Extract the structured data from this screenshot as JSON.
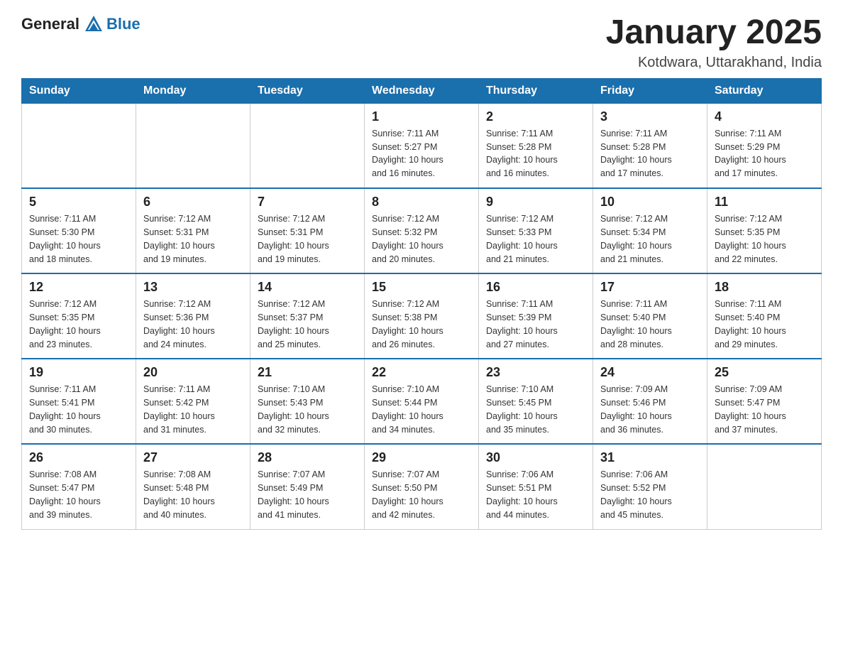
{
  "logo": {
    "text_general": "General",
    "text_blue": "Blue"
  },
  "title": "January 2025",
  "subtitle": "Kotdwara, Uttarakhand, India",
  "days_of_week": [
    "Sunday",
    "Monday",
    "Tuesday",
    "Wednesday",
    "Thursday",
    "Friday",
    "Saturday"
  ],
  "weeks": [
    [
      {
        "day": "",
        "info": ""
      },
      {
        "day": "",
        "info": ""
      },
      {
        "day": "",
        "info": ""
      },
      {
        "day": "1",
        "info": "Sunrise: 7:11 AM\nSunset: 5:27 PM\nDaylight: 10 hours\nand 16 minutes."
      },
      {
        "day": "2",
        "info": "Sunrise: 7:11 AM\nSunset: 5:28 PM\nDaylight: 10 hours\nand 16 minutes."
      },
      {
        "day": "3",
        "info": "Sunrise: 7:11 AM\nSunset: 5:28 PM\nDaylight: 10 hours\nand 17 minutes."
      },
      {
        "day": "4",
        "info": "Sunrise: 7:11 AM\nSunset: 5:29 PM\nDaylight: 10 hours\nand 17 minutes."
      }
    ],
    [
      {
        "day": "5",
        "info": "Sunrise: 7:11 AM\nSunset: 5:30 PM\nDaylight: 10 hours\nand 18 minutes."
      },
      {
        "day": "6",
        "info": "Sunrise: 7:12 AM\nSunset: 5:31 PM\nDaylight: 10 hours\nand 19 minutes."
      },
      {
        "day": "7",
        "info": "Sunrise: 7:12 AM\nSunset: 5:31 PM\nDaylight: 10 hours\nand 19 minutes."
      },
      {
        "day": "8",
        "info": "Sunrise: 7:12 AM\nSunset: 5:32 PM\nDaylight: 10 hours\nand 20 minutes."
      },
      {
        "day": "9",
        "info": "Sunrise: 7:12 AM\nSunset: 5:33 PM\nDaylight: 10 hours\nand 21 minutes."
      },
      {
        "day": "10",
        "info": "Sunrise: 7:12 AM\nSunset: 5:34 PM\nDaylight: 10 hours\nand 21 minutes."
      },
      {
        "day": "11",
        "info": "Sunrise: 7:12 AM\nSunset: 5:35 PM\nDaylight: 10 hours\nand 22 minutes."
      }
    ],
    [
      {
        "day": "12",
        "info": "Sunrise: 7:12 AM\nSunset: 5:35 PM\nDaylight: 10 hours\nand 23 minutes."
      },
      {
        "day": "13",
        "info": "Sunrise: 7:12 AM\nSunset: 5:36 PM\nDaylight: 10 hours\nand 24 minutes."
      },
      {
        "day": "14",
        "info": "Sunrise: 7:12 AM\nSunset: 5:37 PM\nDaylight: 10 hours\nand 25 minutes."
      },
      {
        "day": "15",
        "info": "Sunrise: 7:12 AM\nSunset: 5:38 PM\nDaylight: 10 hours\nand 26 minutes."
      },
      {
        "day": "16",
        "info": "Sunrise: 7:11 AM\nSunset: 5:39 PM\nDaylight: 10 hours\nand 27 minutes."
      },
      {
        "day": "17",
        "info": "Sunrise: 7:11 AM\nSunset: 5:40 PM\nDaylight: 10 hours\nand 28 minutes."
      },
      {
        "day": "18",
        "info": "Sunrise: 7:11 AM\nSunset: 5:40 PM\nDaylight: 10 hours\nand 29 minutes."
      }
    ],
    [
      {
        "day": "19",
        "info": "Sunrise: 7:11 AM\nSunset: 5:41 PM\nDaylight: 10 hours\nand 30 minutes."
      },
      {
        "day": "20",
        "info": "Sunrise: 7:11 AM\nSunset: 5:42 PM\nDaylight: 10 hours\nand 31 minutes."
      },
      {
        "day": "21",
        "info": "Sunrise: 7:10 AM\nSunset: 5:43 PM\nDaylight: 10 hours\nand 32 minutes."
      },
      {
        "day": "22",
        "info": "Sunrise: 7:10 AM\nSunset: 5:44 PM\nDaylight: 10 hours\nand 34 minutes."
      },
      {
        "day": "23",
        "info": "Sunrise: 7:10 AM\nSunset: 5:45 PM\nDaylight: 10 hours\nand 35 minutes."
      },
      {
        "day": "24",
        "info": "Sunrise: 7:09 AM\nSunset: 5:46 PM\nDaylight: 10 hours\nand 36 minutes."
      },
      {
        "day": "25",
        "info": "Sunrise: 7:09 AM\nSunset: 5:47 PM\nDaylight: 10 hours\nand 37 minutes."
      }
    ],
    [
      {
        "day": "26",
        "info": "Sunrise: 7:08 AM\nSunset: 5:47 PM\nDaylight: 10 hours\nand 39 minutes."
      },
      {
        "day": "27",
        "info": "Sunrise: 7:08 AM\nSunset: 5:48 PM\nDaylight: 10 hours\nand 40 minutes."
      },
      {
        "day": "28",
        "info": "Sunrise: 7:07 AM\nSunset: 5:49 PM\nDaylight: 10 hours\nand 41 minutes."
      },
      {
        "day": "29",
        "info": "Sunrise: 7:07 AM\nSunset: 5:50 PM\nDaylight: 10 hours\nand 42 minutes."
      },
      {
        "day": "30",
        "info": "Sunrise: 7:06 AM\nSunset: 5:51 PM\nDaylight: 10 hours\nand 44 minutes."
      },
      {
        "day": "31",
        "info": "Sunrise: 7:06 AM\nSunset: 5:52 PM\nDaylight: 10 hours\nand 45 minutes."
      },
      {
        "day": "",
        "info": ""
      }
    ]
  ]
}
